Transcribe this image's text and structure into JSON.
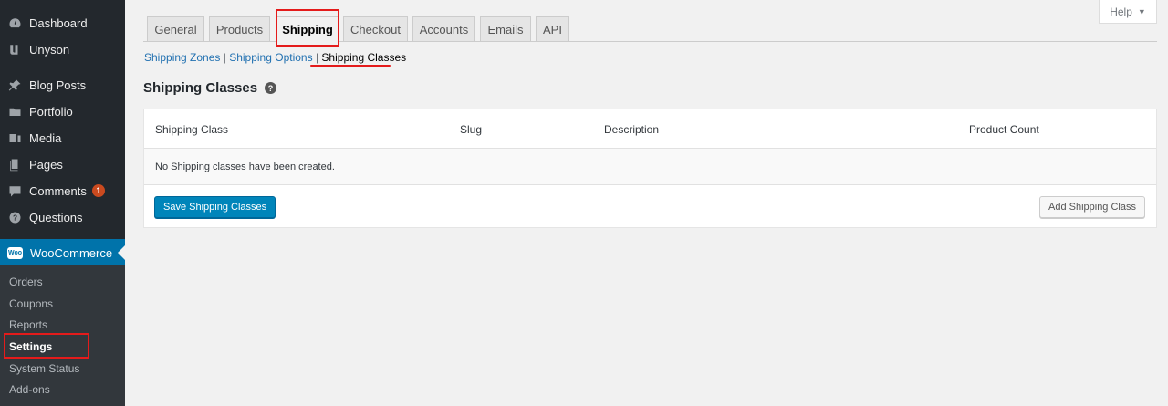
{
  "sidebar": {
    "menu": [
      {
        "label": "Dashboard",
        "icon": "dashboard-icon"
      },
      {
        "label": "Unyson",
        "icon": "unyson-icon"
      },
      {
        "label": "Blog Posts",
        "icon": "pin-icon"
      },
      {
        "label": "Portfolio",
        "icon": "folder-icon"
      },
      {
        "label": "Media",
        "icon": "media-icon"
      },
      {
        "label": "Pages",
        "icon": "pages-icon"
      },
      {
        "label": "Comments",
        "icon": "comment-icon",
        "badge": "1"
      },
      {
        "label": "Questions",
        "icon": "question-icon"
      },
      {
        "label": "WooCommerce",
        "icon": "woocommerce-icon"
      }
    ],
    "woo_icon_text": "Woo",
    "submenu": [
      "Orders",
      "Coupons",
      "Reports",
      "Settings",
      "System Status",
      "Add-ons"
    ]
  },
  "help": {
    "label": "Help",
    "caret": "▼"
  },
  "tabs": [
    "General",
    "Products",
    "Shipping",
    "Checkout",
    "Accounts",
    "Emails",
    "API"
  ],
  "subsub": {
    "zones": "Shipping Zones",
    "options": "Shipping Options",
    "classes": "Shipping Classes",
    "sep": "|"
  },
  "heading": {
    "title": "Shipping Classes",
    "help_mark": "?"
  },
  "table": {
    "columns": [
      "Shipping Class",
      "Slug",
      "Description",
      "Product Count"
    ],
    "empty_message": "No Shipping classes have been created.",
    "save_button": "Save Shipping Classes",
    "add_button": "Add Shipping Class"
  },
  "colors": {
    "accent": "#0073aa",
    "highlight": "#e41b1b",
    "badge": "#ca4a1f"
  }
}
